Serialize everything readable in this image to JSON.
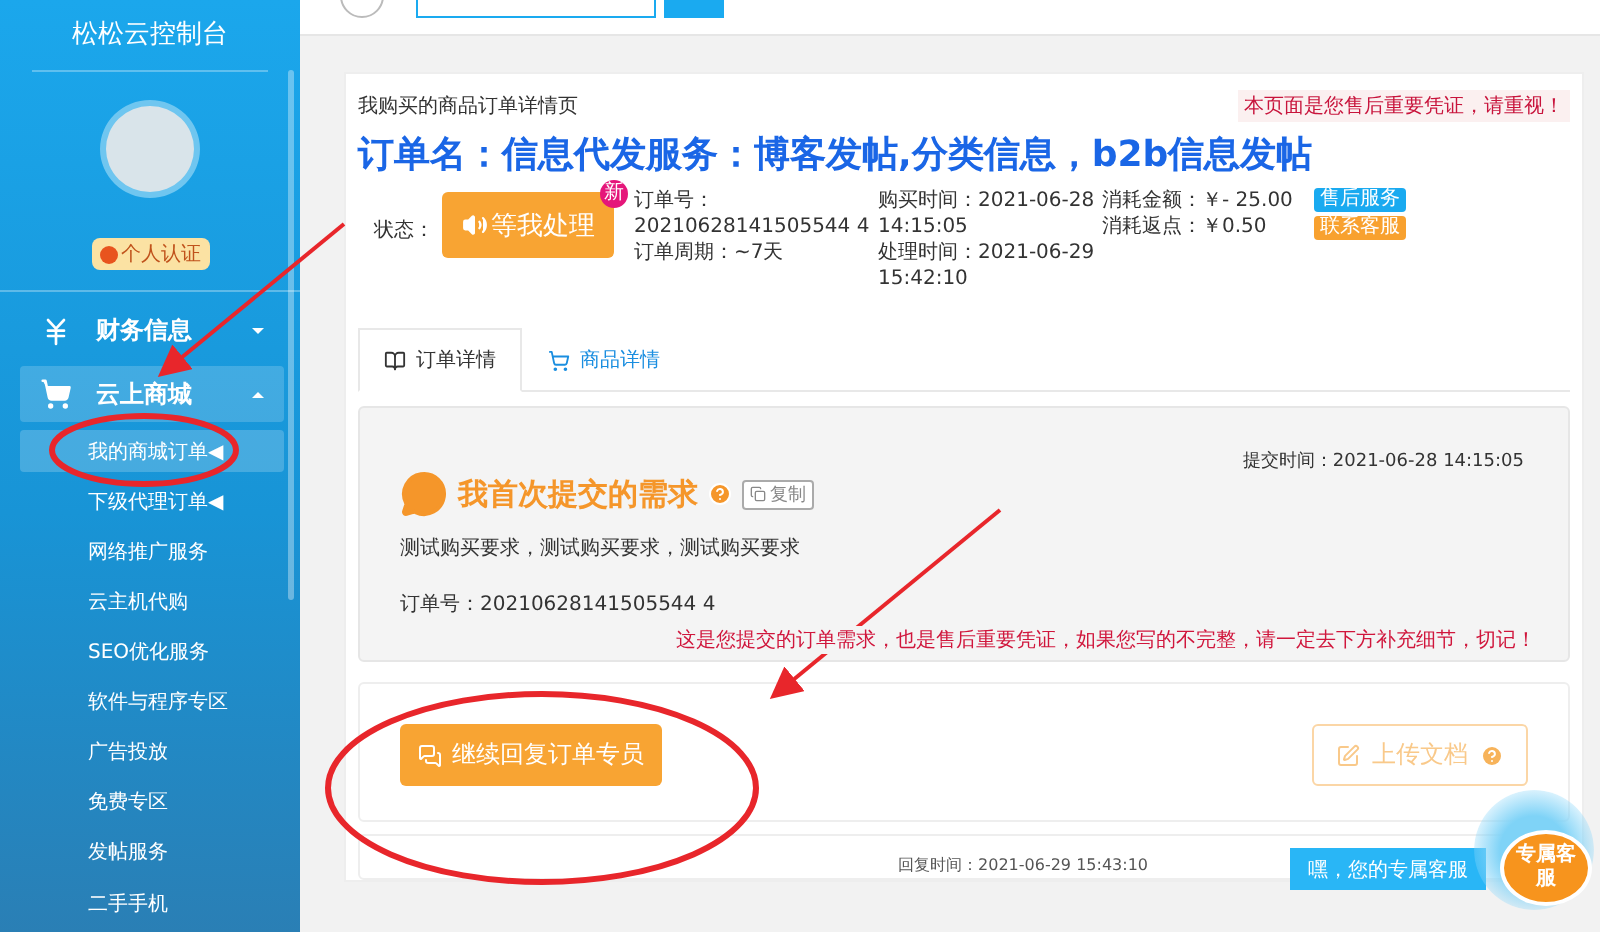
{
  "sidebar": {
    "title": "松松云控制台",
    "badge": "个人认证",
    "menu": [
      {
        "label": "财务信息",
        "kind": "finance",
        "expanded": false,
        "selected": false
      },
      {
        "label": "云上商城",
        "kind": "shop",
        "expanded": true,
        "selected": true
      }
    ],
    "items": [
      {
        "label": "我的商城订单◀",
        "selected": true
      },
      {
        "label": "下级代理订单◀",
        "selected": false
      },
      {
        "label": "网络推广服务",
        "selected": false
      },
      {
        "label": "云主机代购",
        "selected": false
      },
      {
        "label": "SEO优化服务",
        "selected": false
      },
      {
        "label": "软件与程序专区",
        "selected": false
      },
      {
        "label": "广告投放",
        "selected": false
      },
      {
        "label": "免费专区",
        "selected": false
      },
      {
        "label": "发帖服务",
        "selected": false
      },
      {
        "label": "二手手机",
        "selected": false
      }
    ]
  },
  "page": {
    "breadcrumb": "我购买的商品订单详情页",
    "notice": "本页面是您售后重要凭证，请重视！",
    "title": "订单名：信息代发服务：博客发帖,分类信息，b2b信息发帖",
    "status_label": "状态：",
    "status_button": "等我处理",
    "new_badge": "新",
    "info_columns": [
      [
        "订单号：",
        "20210628141505544 4",
        "订单周期：~7天"
      ],
      [
        "购买时间：2021-06-28",
        "14:15:05",
        "处理时间：2021-06-29",
        "15:42:10"
      ],
      [
        "消耗金额：￥- 25.00",
        "消耗返点：￥0.50"
      ]
    ],
    "tags": [
      {
        "label": "售后服务",
        "color": "#1aaaf0"
      },
      {
        "label": "联系客服",
        "color": "#f8a12f"
      }
    ],
    "tabs": [
      {
        "label": "订单详情",
        "kind": "book",
        "selected": true
      },
      {
        "label": "商品详情",
        "kind": "cart",
        "selected": false
      }
    ],
    "requirement": {
      "submit_time": "提交时间：2021-06-28 14:15:05",
      "heading": "我首次提交的需求",
      "copy": "复制",
      "text": "测试购买要求，测试购买要求，测试购买要求",
      "order_no": "订单号：20210628141505544 4",
      "warning": "这是您提交的订单需求，也是售后重要凭证，如果您写的不完整，请一定去下方补充细节，切记！"
    },
    "reply_button": "继续回复订单专员",
    "upload_button": "上传文档",
    "reply_time": "回复时间：2021-06-29 15:43:10"
  },
  "support": {
    "tooltip": "嘿，您的专属客服",
    "label": "专属客服"
  }
}
